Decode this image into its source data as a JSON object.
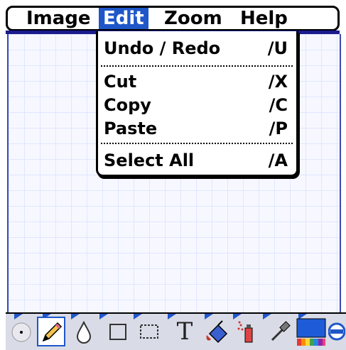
{
  "menubar": {
    "items": [
      {
        "label": "Image",
        "active": false
      },
      {
        "label": "Edit",
        "active": true
      },
      {
        "label": "Zoom",
        "active": false
      },
      {
        "label": "Help",
        "active": false
      }
    ]
  },
  "edit_menu": {
    "groups": [
      [
        {
          "label": "Undo / Redo",
          "shortcut": "∕U"
        }
      ],
      [
        {
          "label": "Cut",
          "shortcut": "∕X"
        },
        {
          "label": "Copy",
          "shortcut": "∕C"
        },
        {
          "label": "Paste",
          "shortcut": "∕P"
        }
      ],
      [
        {
          "label": "Select All",
          "shortcut": "∕A"
        }
      ]
    ]
  },
  "toolbar": {
    "tools": [
      {
        "icon": "dot-brush-icon",
        "selected": false
      },
      {
        "icon": "pencil-icon",
        "selected": true
      },
      {
        "icon": "drop-icon",
        "selected": false
      },
      {
        "icon": "rectangle-icon",
        "selected": false
      },
      {
        "icon": "selection-rectangle-icon",
        "selected": false
      },
      {
        "icon": "text-icon",
        "selected": false,
        "glyph": "T"
      },
      {
        "icon": "paint-bucket-icon",
        "selected": false
      },
      {
        "icon": "spray-can-icon",
        "selected": false
      },
      {
        "icon": "eyedropper-icon",
        "selected": false
      },
      {
        "icon": "color-palette-icon",
        "selected": false
      },
      {
        "icon": "line-width-icon",
        "selected": false
      }
    ],
    "colors": {
      "accent": "#1f57c9",
      "palette_main": "#1e5bd6"
    }
  }
}
